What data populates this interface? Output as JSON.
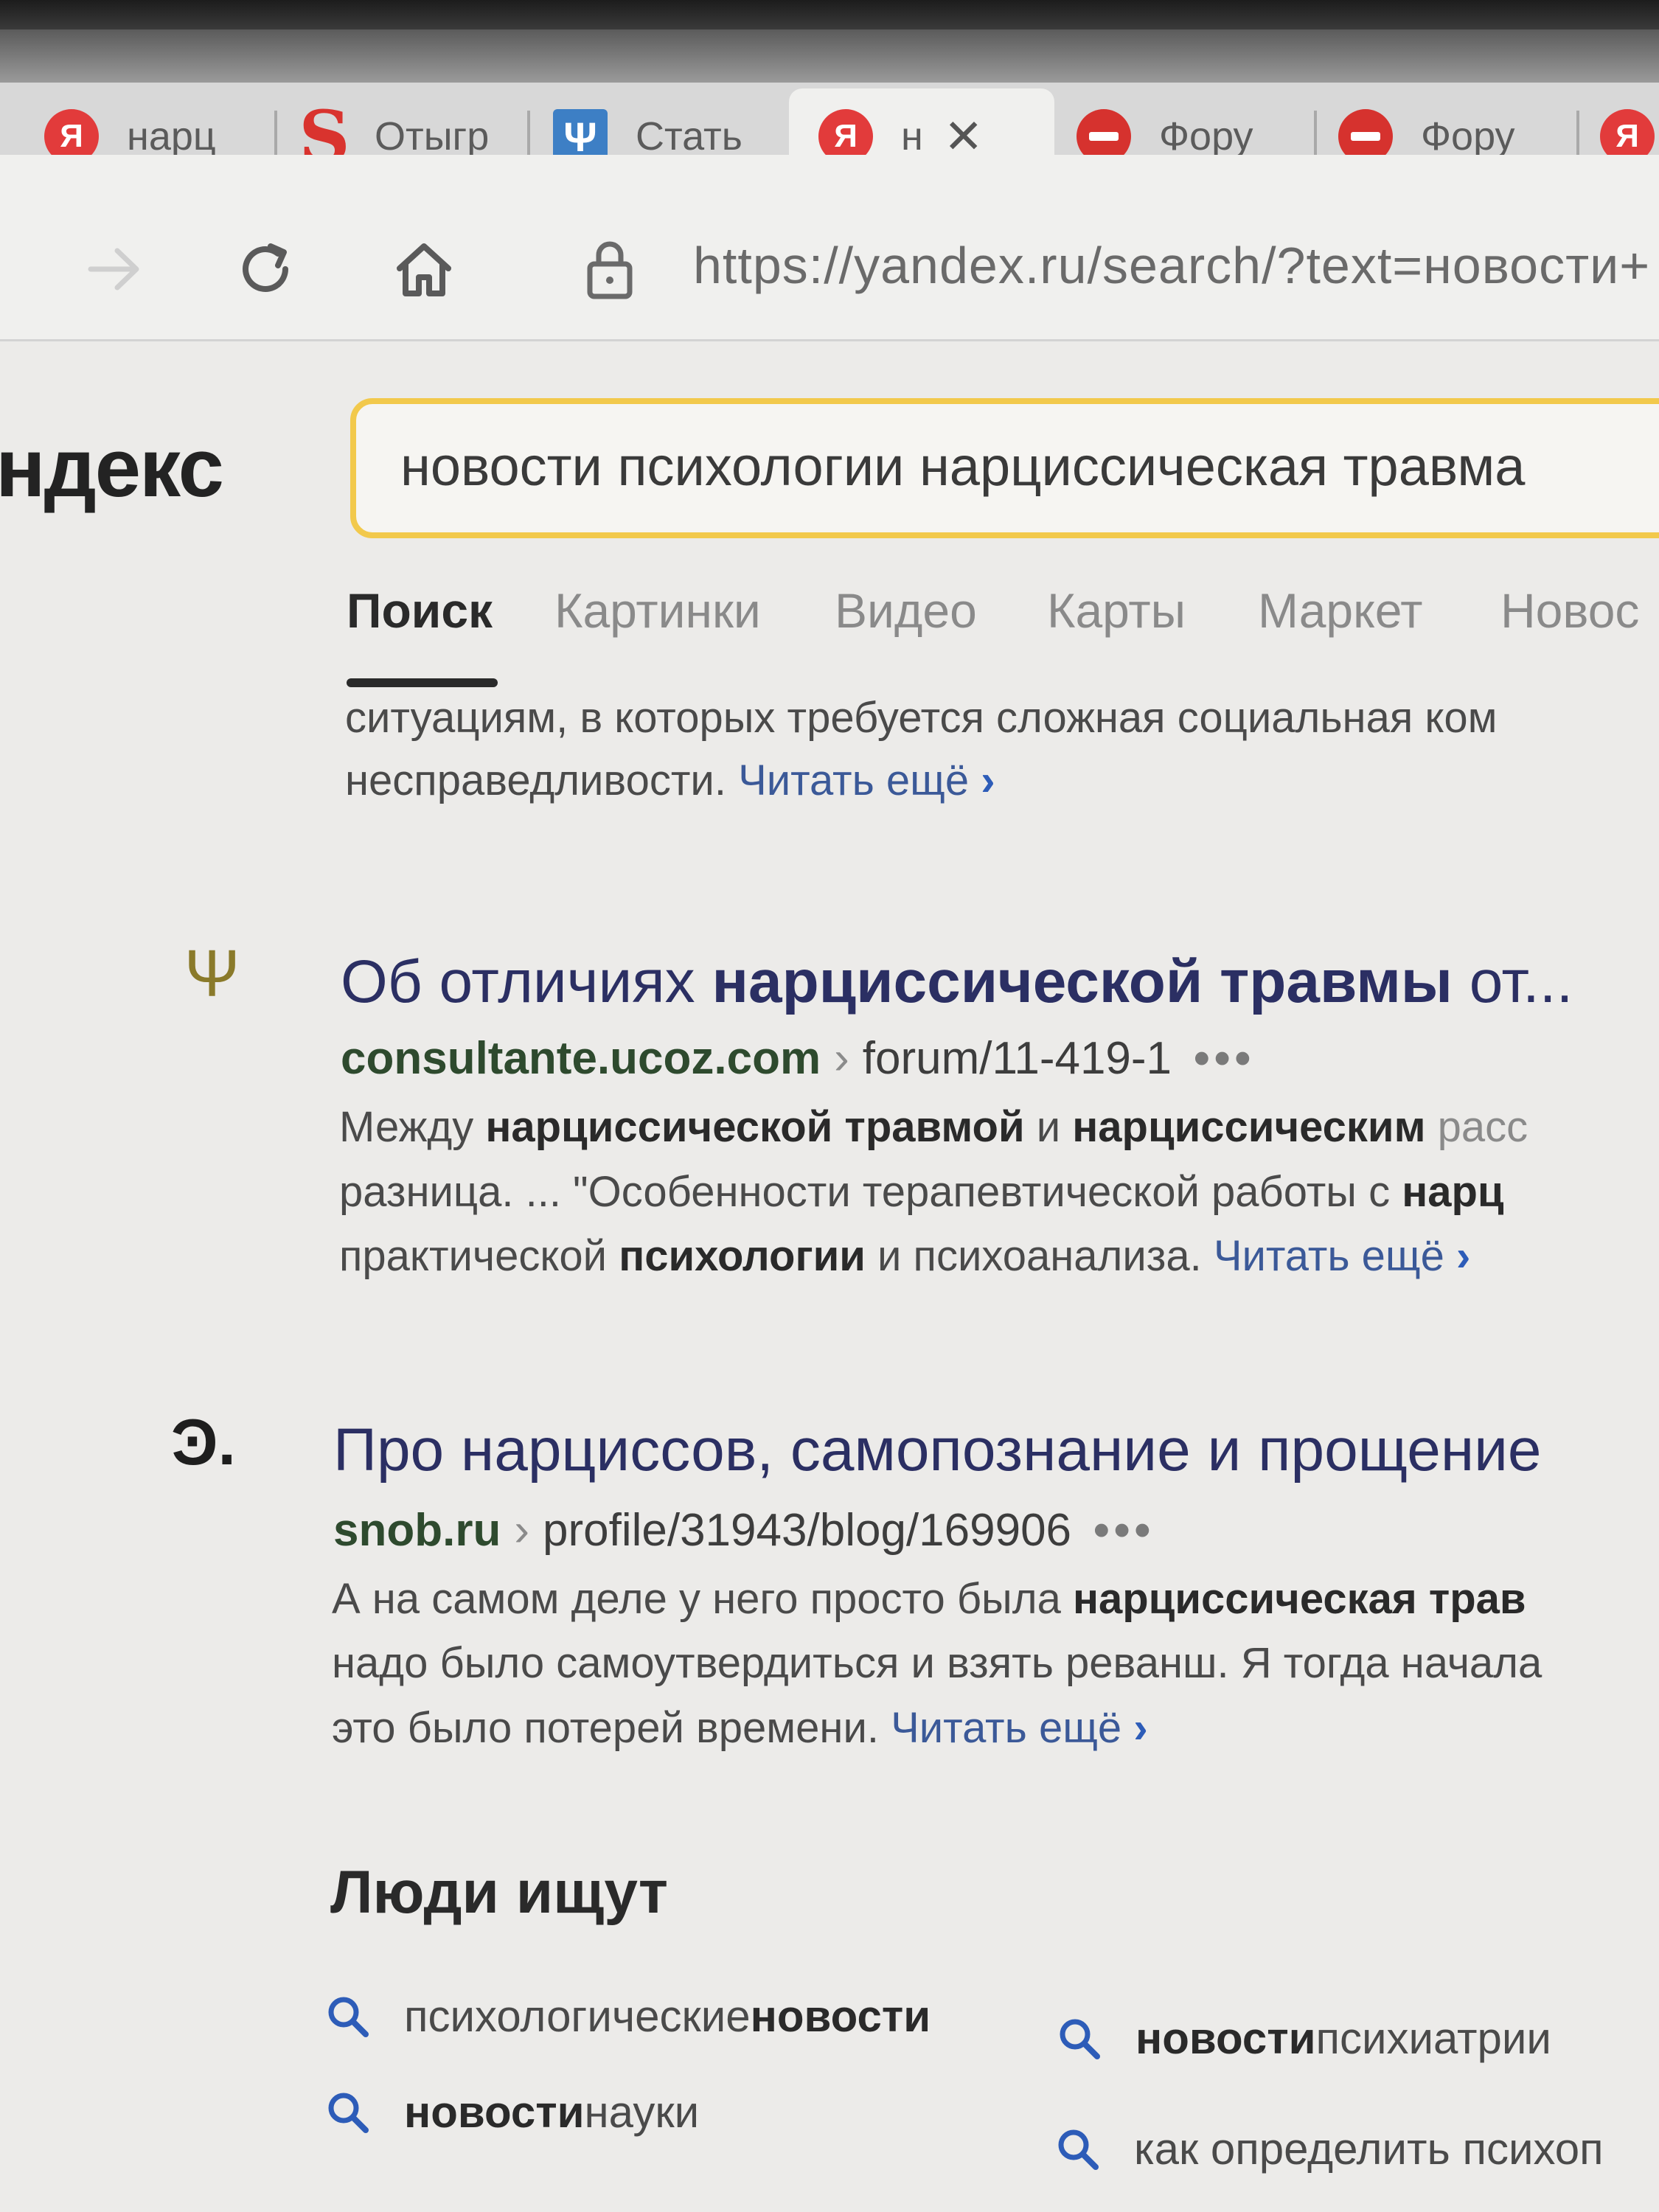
{
  "browser": {
    "tabs": [
      {
        "label": "нарц",
        "favicon": "yandex-icon"
      },
      {
        "label": "Отыгр",
        "favicon": "s-icon"
      },
      {
        "label": "Стать",
        "favicon": "psi-icon"
      },
      {
        "label": "н",
        "favicon": "yandex-icon",
        "active": true
      },
      {
        "label": "Фору",
        "favicon": "blocked-icon"
      },
      {
        "label": "Фору",
        "favicon": "blocked-icon"
      }
    ],
    "close_glyph": "✕",
    "url": "https://yandex.ru/search/?text=новости+"
  },
  "logo_text": "ндекс",
  "search": {
    "value": "новости психологии нарциссическая травма"
  },
  "services": [
    "Поиск",
    "Картинки",
    "Видео",
    "Карты",
    "Маркет",
    "Новос"
  ],
  "prev_snippet": {
    "line1": "ситуациям, в которых требуется сложная социальная ком",
    "line2": "несправедливости.",
    "more": "Читать ещё"
  },
  "results": [
    {
      "title_plain": "Об отличиях ",
      "title_bold": "нарциссической травмы",
      "title_tail": " от...",
      "domain": "consultante.ucoz.com",
      "path": "forum/11-419-1",
      "snippet": {
        "l1_a": "Между ",
        "l1_b": "нарциссической травмой",
        "l1_c": " и ",
        "l1_d": "нарциссическим",
        "l1_e": " расс",
        "l2_a": "разница. ... \"Особенности терапевтической работы с ",
        "l2_b": "нарц",
        "l3_a": "практической ",
        "l3_b": "психологии",
        "l3_c": " и психоанализа.",
        "more": "Читать ещё"
      }
    },
    {
      "title_plain": "Про нарциссов, самопознание и прощение",
      "domain": "snob.ru",
      "path": "profile/31943/blog/169906",
      "snippet": {
        "l1_a": "А на самом деле у него просто была ",
        "l1_b": "нарциссическая трав",
        "l2": "надо было самоутвердиться и взять реванш. Я тогда начала",
        "l3": "это было потерей времени.",
        "more": "Читать ещё"
      }
    }
  ],
  "people_search": {
    "title": "Люди ищут",
    "items": [
      {
        "plain": "психологические ",
        "bold": "новости",
        "order": "plain-first"
      },
      {
        "plain": " психиатрии",
        "bold": "новости",
        "order": "bold-first"
      },
      {
        "plain": " науки",
        "bold": "новости",
        "order": "bold-first"
      },
      {
        "plain": "как определить психоп",
        "bold": "",
        "order": "plain-first"
      }
    ]
  },
  "colors": {
    "search_border": "#f2c94c",
    "link": "#2b2f63",
    "more_link": "#2d5cb8"
  }
}
